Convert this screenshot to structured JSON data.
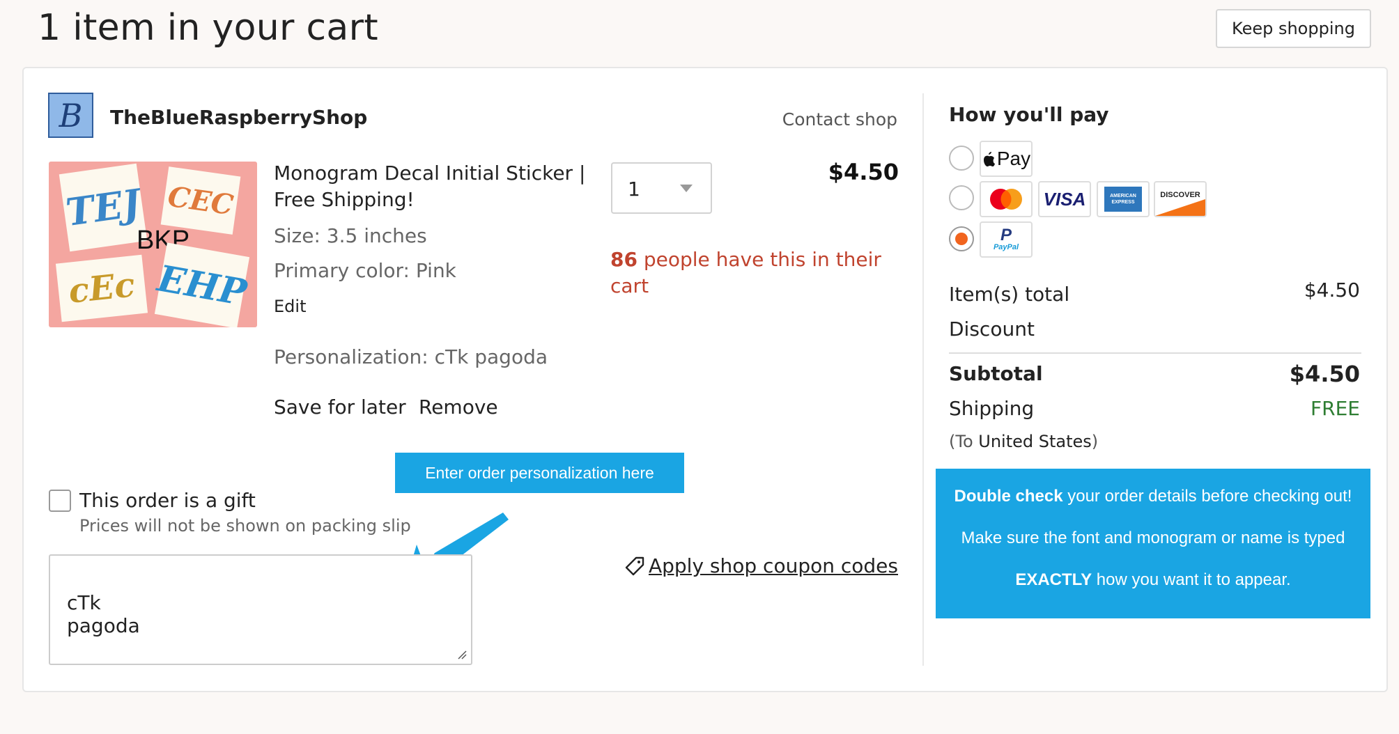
{
  "header": {
    "title": "1 item in your cart",
    "keep_shopping": "Keep shopping"
  },
  "shop": {
    "logo_text": "B",
    "name": "TheBlueRaspberryShop",
    "contact": "Contact shop"
  },
  "item": {
    "title": "Monogram Decal Initial Sticker | Free Shipping!",
    "size": "Size: 3.5 inches",
    "color": "Primary color: Pink",
    "edit": "Edit",
    "personalization": "Personalization: cTk pagoda",
    "save_for_later": "Save for later",
    "remove": "Remove",
    "quantity": "1",
    "price": "$4.50",
    "cart_count": "86",
    "cart_notice": "people have this in their cart",
    "image_stickers": [
      "TEJ",
      "CEC",
      "BKP",
      "cEc",
      "EHP"
    ]
  },
  "annotation": {
    "banner": "Enter order personalization here"
  },
  "gift": {
    "label": "This order is a gift",
    "sub": "Prices will not be shown on packing slip"
  },
  "note": {
    "value": "cTk\npagoda"
  },
  "coupon": {
    "label": " Apply shop coupon codes"
  },
  "payment": {
    "title": "How you'll pay",
    "apple_pay": "Pay",
    "visa": "VISA",
    "amex": "AMERICAN EXPRESS",
    "discover": "DISCOVER",
    "paypal": "PayPal",
    "selected": "paypal"
  },
  "summary": {
    "items_total_label": "Item(s) total",
    "items_total_value": "$4.50",
    "discount_label": "Discount",
    "subtotal_label": "Subtotal",
    "subtotal_value": "$4.50",
    "shipping_label": "Shipping",
    "shipping_value": "FREE",
    "shipping_dest_prefix": "(To ",
    "shipping_dest": "United States",
    "shipping_dest_suffix": ")"
  },
  "info": {
    "bold1": "Double check",
    "text1": " your order details before checking out! Make sure the font and monogram or name is typed ",
    "bold2": "EXACTLY",
    "text2": " how you want it to appear."
  },
  "colors": {
    "accent_blue": "#1aa5e3",
    "notice_red": "#c0432e",
    "free_green": "#2e7d32",
    "radio_orange": "#f1641e"
  }
}
